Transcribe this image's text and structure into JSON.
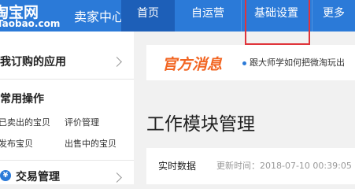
{
  "logo": {
    "main": "淘宝网",
    "sub": "Taobao.com"
  },
  "app_title": "卖家中心",
  "nav": {
    "home": "首页",
    "self_operated": "自运营",
    "basic_settings": "基础设置",
    "more": "更多"
  },
  "sidebar": {
    "subscribed_apps": "我订购的应用",
    "common_ops": {
      "title": "常用操作",
      "links": [
        "已卖出的宝贝",
        "评价管理",
        "发布宝贝",
        "出售中的宝贝"
      ]
    },
    "trade_management": "交易管理"
  },
  "notice": {
    "title": "官方消息",
    "text": "跟大师学如何把微淘玩出"
  },
  "page_title": "工作模块管理",
  "data_panel": {
    "realtime_label": "实时数据",
    "update_time": "更新时间：2018-07-10 00:39:05"
  },
  "colors": {
    "topbar": "#2b7ad8",
    "active_nav": "#1d5fb8",
    "highlight_box": "#e0343a",
    "notice_title": "#f26522"
  }
}
